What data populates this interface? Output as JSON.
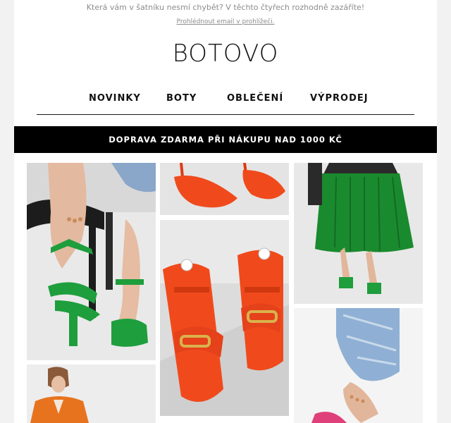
{
  "email": {
    "preheader_text": "Která vám v šatníku nesmí chybět? V těchto čtyřech rozhodně zazáříte!",
    "view_in_browser_link": "Prohlédnout email v prohlížeči.",
    "brand_logo": "BOTOVO",
    "nav": {
      "items": [
        {
          "label": "NOVINKY"
        },
        {
          "label": "BOTY"
        },
        {
          "label": "OBLEČENÍ"
        },
        {
          "label": "VÝPRODEJ"
        }
      ]
    },
    "promo_banner": "DOPRAVA ZDARMA PŘI NÁKUPU NAD 1000 KČ",
    "colors": {
      "brand_black": "#000000",
      "shoe_green": "#1e9e3c",
      "shoe_orange": "#f04a1c",
      "dress_green": "#1a8a2e",
      "jacket_orange": "#e8731e"
    },
    "product_tiles": [
      {
        "name": "green-strappy-heels-photo"
      },
      {
        "name": "orange-pointed-pumps-photo"
      },
      {
        "name": "green-pleated-dress-photo"
      },
      {
        "name": "orange-chain-slides-photo"
      },
      {
        "name": "orange-blazer-photo"
      },
      {
        "name": "denim-pink-heels-photo"
      }
    ]
  }
}
